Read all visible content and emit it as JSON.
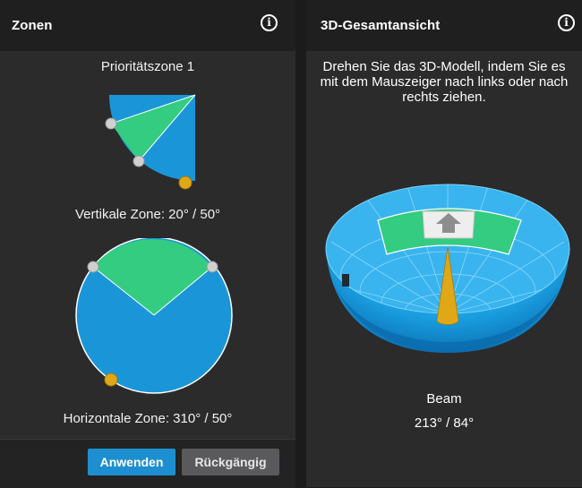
{
  "left_panel": {
    "title": "Zonen",
    "info_icon": "info-icon",
    "priority_zone_label": "Prioritätszone 1",
    "vertical_zone_label": "Vertikale Zone: 20° / 50°",
    "horizontal_zone_label": "Horizontale Zone: 310° / 50°",
    "apply_label": "Anwenden",
    "undo_label": "Rückgängig"
  },
  "right_panel": {
    "title": "3D-Gesamtansicht",
    "info_icon": "info-icon",
    "instruction": "Drehen Sie das 3D-Modell, indem Sie es mit dem Mauszeiger nach links oder nach rechts ziehen.",
    "beam_title": "Beam",
    "beam_values": "213° / 84°"
  },
  "colors": {
    "accent_blue": "#1d8fd0",
    "zone_green": "#33cc80",
    "handle_yellow": "#e0a817",
    "handle_grey": "#d0d0d0",
    "sphere_blue": "#1a9fe0"
  }
}
